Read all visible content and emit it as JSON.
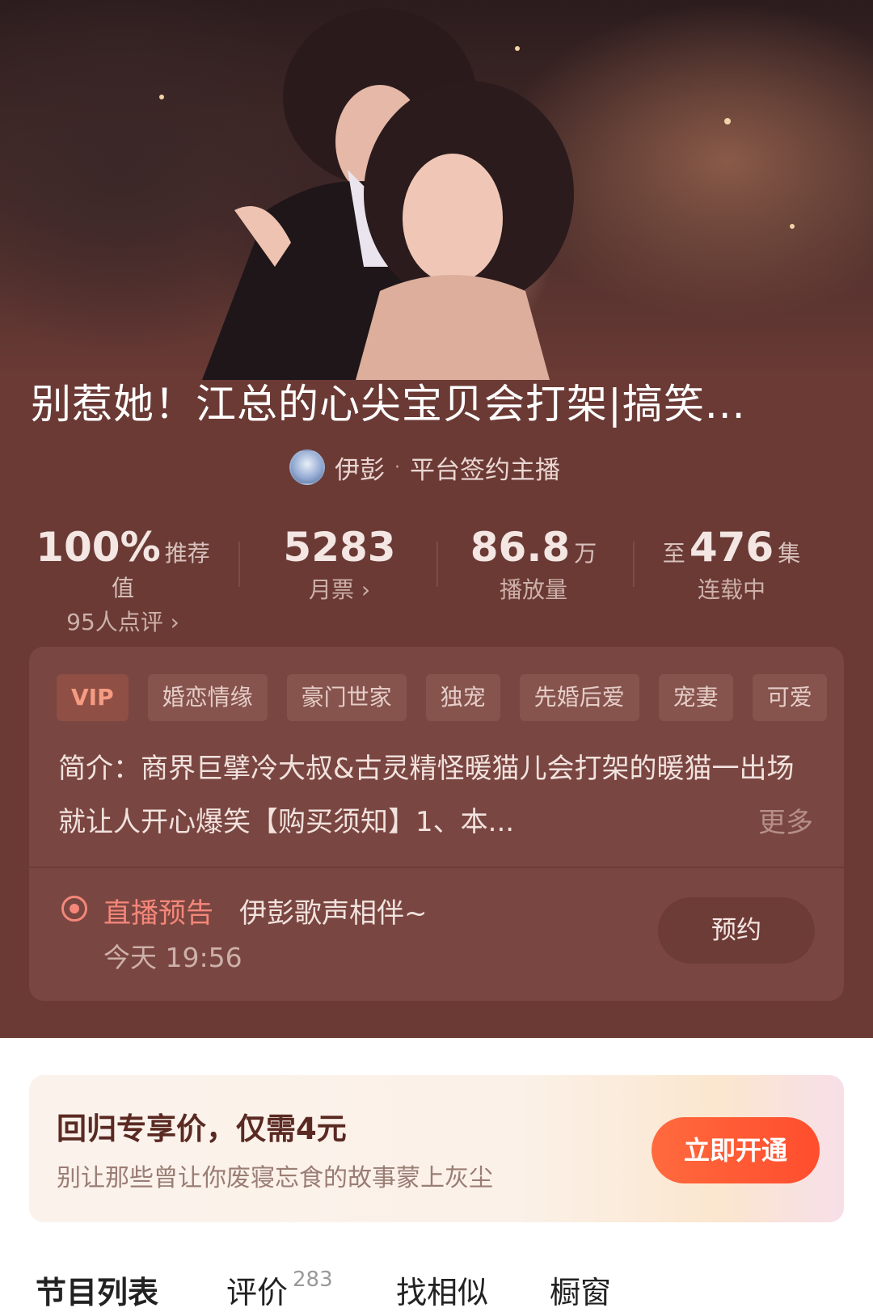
{
  "cover": {
    "alt": "cover-artwork"
  },
  "title": "别惹她！江总的心尖宝贝会打架|搞笑...",
  "author": {
    "name": "伊彭",
    "separator": "·",
    "role": "平台签约主播"
  },
  "stats": [
    {
      "value": "100%",
      "unit": "推荐值",
      "sub": "95人点评 ›"
    },
    {
      "value": "5283",
      "unit": "",
      "sub": "月票 ›"
    },
    {
      "value": "86.8",
      "unit": "万",
      "sub": "播放量"
    },
    {
      "prefix": "至",
      "value": "476",
      "unit": "集",
      "sub": "连载中"
    }
  ],
  "tags": [
    "VIP",
    "婚恋情缘",
    "豪门世家",
    "独宠",
    "先婚后爱",
    "宠妻",
    "可爱"
  ],
  "intro": {
    "text": "简介：商界巨擘冷大叔&古灵精怪暖猫儿会打架的暖猫一出场就让人开心爆笑【购买须知】1、本...",
    "more": "更多"
  },
  "live": {
    "label": "直播预告",
    "title": "伊彭歌声相伴~",
    "time": "今天 19:56",
    "button": "预约"
  },
  "promo": {
    "title": "回归专享价，仅需4元",
    "subtitle": "别让那些曾让你废寝忘食的故事蒙上灰尘",
    "button": "立即开通"
  },
  "tabs": [
    {
      "label": "节目列表",
      "count": ""
    },
    {
      "label": "评价",
      "count": "283"
    },
    {
      "label": "找相似",
      "count": ""
    },
    {
      "label": "橱窗",
      "count": ""
    }
  ]
}
